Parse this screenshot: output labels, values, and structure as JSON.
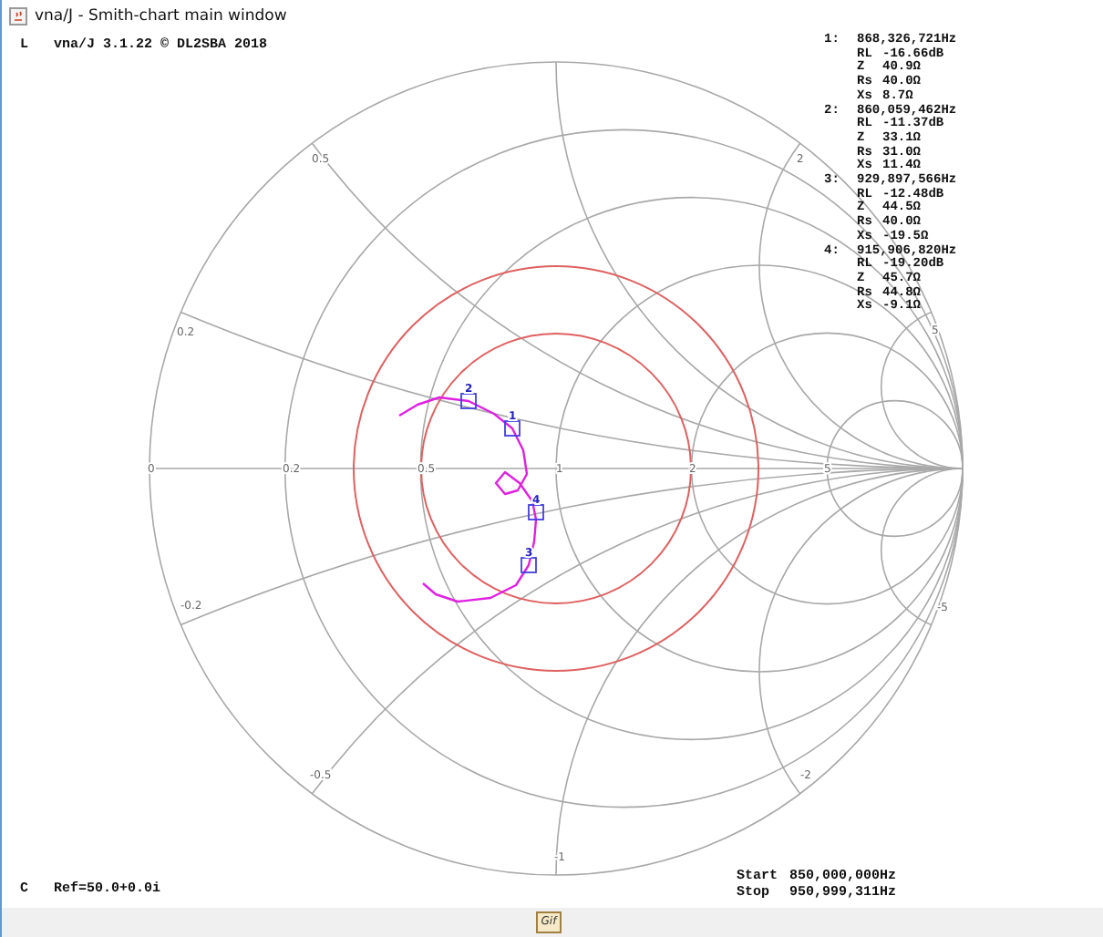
{
  "window": {
    "title": "vna/J - Smith-chart main window"
  },
  "header": {
    "mode": "L",
    "version": "vna/J 3.1.22 © DL2SBA 2018"
  },
  "markers": [
    {
      "index": "1:",
      "frequency": "868,326,721Hz",
      "tag": "1",
      "fields": [
        {
          "label": "RL",
          "value": "-16.66dB"
        },
        {
          "label": "Z",
          "value": "40.9Ω"
        },
        {
          "label": "Rs",
          "value": "40.0Ω"
        },
        {
          "label": "Xs",
          "value": "8.7Ω"
        }
      ]
    },
    {
      "index": "2:",
      "frequency": "860,059,462Hz",
      "tag": "2",
      "fields": [
        {
          "label": "RL",
          "value": "-11.37dB"
        },
        {
          "label": "Z",
          "value": "33.1Ω"
        },
        {
          "label": "Rs",
          "value": "31.0Ω"
        },
        {
          "label": "Xs",
          "value": "11.4Ω"
        }
      ]
    },
    {
      "index": "3:",
      "frequency": "929,897,566Hz",
      "tag": "3",
      "fields": [
        {
          "label": "RL",
          "value": "-12.48dB"
        },
        {
          "label": "Z",
          "value": "44.5Ω"
        },
        {
          "label": "Rs",
          "value": "40.0Ω"
        },
        {
          "label": "Xs",
          "value": "-19.5Ω"
        }
      ]
    },
    {
      "index": "4:",
      "frequency": "915,906,820Hz",
      "tag": "4",
      "fields": [
        {
          "label": "RL",
          "value": "-19.20dB"
        },
        {
          "label": "Z",
          "value": "45.7Ω"
        },
        {
          "label": "Rs",
          "value": "44.8Ω"
        },
        {
          "label": "Xs",
          "value": "-9.1Ω"
        }
      ]
    }
  ],
  "grid_labels": [
    {
      "text": "0.5"
    },
    {
      "text": "2"
    },
    {
      "text": "0.2"
    },
    {
      "text": "5"
    },
    {
      "text": "0"
    },
    {
      "text": "0.2"
    },
    {
      "text": "0.5"
    },
    {
      "text": "1"
    },
    {
      "text": "2"
    },
    {
      "text": "5"
    },
    {
      "text": "-0.2"
    },
    {
      "text": "-5"
    },
    {
      "text": "-0.5"
    },
    {
      "text": "-2"
    },
    {
      "text": "-1"
    }
  ],
  "footer": {
    "mode": "C",
    "reference": "Ref=50.0+0.0i",
    "start_label": "Start",
    "start": "850,000,000Hz",
    "stop_label": "Stop",
    "stop": "950,999,311Hz"
  },
  "button": {
    "label": "Gif"
  }
}
